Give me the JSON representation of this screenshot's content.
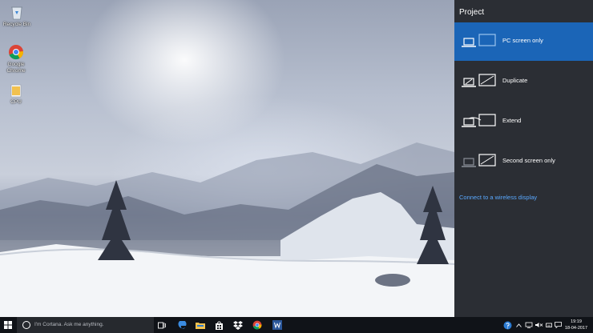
{
  "desktop": {
    "icons": [
      {
        "label": "Recycle Bin",
        "icon": "recycle-bin-icon"
      },
      {
        "label": "Google Chrome",
        "icon": "chrome-icon"
      },
      {
        "label": "CPU",
        "icon": "folder-icon"
      }
    ]
  },
  "project_panel": {
    "title": "Project",
    "options": [
      {
        "label": "PC screen only",
        "icon": "pc-screen-only-icon",
        "selected": true
      },
      {
        "label": "Duplicate",
        "icon": "duplicate-icon",
        "selected": false
      },
      {
        "label": "Extend",
        "icon": "extend-icon",
        "selected": false
      },
      {
        "label": "Second screen only",
        "icon": "second-screen-only-icon",
        "selected": false
      }
    ],
    "wireless_link": "Connect to a wireless display",
    "accent_color": "#1b65b7"
  },
  "taskbar": {
    "search_placeholder": "I'm Cortana. Ask me anything.",
    "pinned": [
      {
        "name": "task-view-icon"
      },
      {
        "name": "edge-icon"
      },
      {
        "name": "file-explorer-icon"
      },
      {
        "name": "store-icon"
      },
      {
        "name": "dropbox-icon"
      },
      {
        "name": "chrome-icon"
      },
      {
        "name": "word-icon"
      }
    ],
    "tray": {
      "time": "19:19",
      "date": "18-04-2017"
    }
  }
}
